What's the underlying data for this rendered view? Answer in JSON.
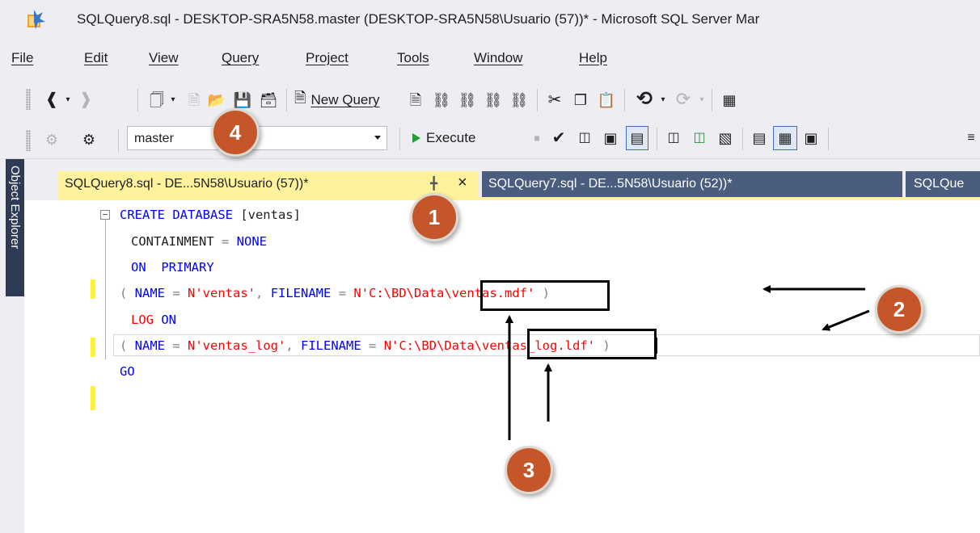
{
  "window": {
    "title": "SQLQuery8.sql - DESKTOP-SRA5N58.master (DESKTOP-SRA5N58\\Usuario (57))* - Microsoft SQL Server Mar"
  },
  "menu": [
    "File",
    "Edit",
    "View",
    "Query",
    "Project",
    "Tools",
    "Window",
    "Help"
  ],
  "toolbar1": {
    "new_query_label": "New Query"
  },
  "toolbar2": {
    "database": "master",
    "execute_label": "Execute"
  },
  "left_rail": {
    "object_explorer_label": "Object Explorer"
  },
  "tabs": [
    {
      "label": "SQLQuery8.sql - DE...5N58\\Usuario (57))*",
      "active": true
    },
    {
      "label": "SQLQuery7.sql - DE...5N58\\Usuario (52))*",
      "active": false
    },
    {
      "label": "SQLQue",
      "active": false
    }
  ],
  "editor": {
    "lines": [
      "CREATE DATABASE [ventas]",
      "CONTAINMENT = NONE",
      "ON  PRIMARY",
      "( NAME = N'ventas', FILENAME = N'C:\\BD\\Data\\ventas.mdf' )",
      "LOG ON",
      "( NAME = N'ventas_log', FILENAME = N'C:\\BD\\Data\\ventas_log.ldf' )",
      "GO"
    ]
  },
  "annotations": {
    "badges": [
      "1",
      "2",
      "3",
      "4"
    ],
    "badge_color": "#c4562a"
  },
  "colors": {
    "keyword": "#0000ff",
    "string": "#ff0000",
    "active_tab": "#fff29d",
    "inactive_tab": "#4a5d7e",
    "chrome": "#eeeef2"
  }
}
